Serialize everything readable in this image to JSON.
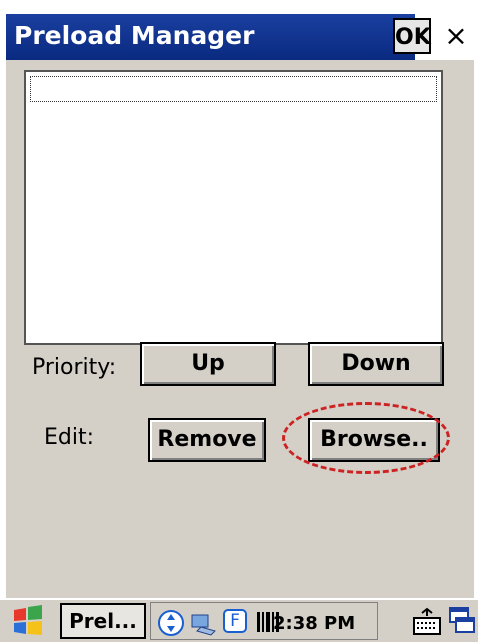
{
  "window": {
    "title": "Preload Manager",
    "ok_label": "OK",
    "close_label": "×"
  },
  "list": {
    "items": []
  },
  "priority": {
    "label": "Priority:",
    "up_label": "Up",
    "down_label": "Down"
  },
  "edit": {
    "label": "Edit:",
    "remove_label": "Remove",
    "browse_label": "Browse.."
  },
  "taskbar": {
    "app_button_label": "Prel...",
    "clock": "2:38 PM",
    "tray_f_label": "F"
  },
  "colors": {
    "titlebar": "#0a2a80",
    "dialog_bg": "#d4d0c8",
    "highlight": "#cc2222"
  }
}
